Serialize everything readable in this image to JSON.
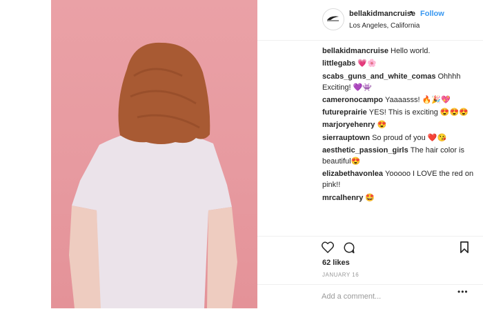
{
  "post": {
    "username": "bellakidmancruise",
    "separator": "•",
    "follow_label": "Follow",
    "location": "Los Angeles, California",
    "comments": [
      {
        "user": "bellakidmancruise",
        "text": "Hello world."
      },
      {
        "user": "littlegabs",
        "text": "💗🌸"
      },
      {
        "user": "scabs_guns_and_white_comas",
        "text": "Ohhhh Exciting! 💜👾"
      },
      {
        "user": "cameronocampo",
        "text": "Yaaaasss! 🔥🎉💖"
      },
      {
        "user": "futureprairie",
        "text": "YES! This is exciting 😍😍😍"
      },
      {
        "user": "marjoryehenry",
        "text": "😍"
      },
      {
        "user": "sierrauptown",
        "text": "So proud of you ❤️😘"
      },
      {
        "user": "aesthetic_passion_girls",
        "text": "The hair color is beautiful😍"
      },
      {
        "user": "elizabethavonlea",
        "text": "Yooooo I LOVE the red on pink!!"
      },
      {
        "user": "mrcalhenry",
        "text": "🤩"
      }
    ],
    "likes": "62 likes",
    "date": "JANUARY 16",
    "comment_placeholder": "Add a comment...",
    "more_label": "•••"
  },
  "icons": {
    "like": "heart-icon",
    "comment": "comment-bubble-icon",
    "save": "bookmark-icon",
    "avatar": "logo-icon"
  },
  "colors": {
    "background_photo": "#e89ca1",
    "link_blue": "#3897f0",
    "text": "#262626",
    "muted": "#999999"
  }
}
